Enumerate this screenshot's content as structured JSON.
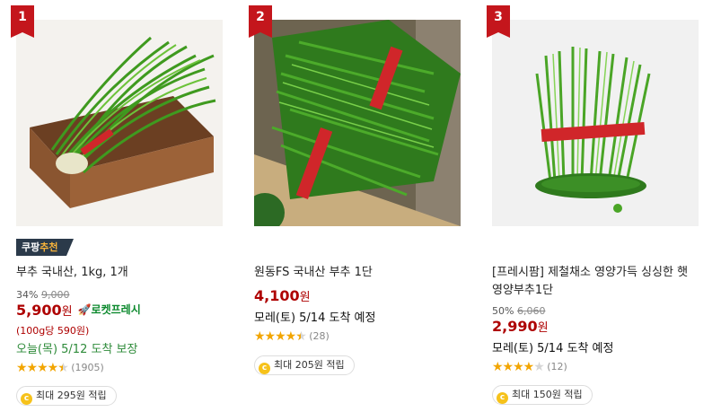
{
  "products": [
    {
      "rank": "1",
      "badge": {
        "prefix": "쿠팡",
        "accent": "추천"
      },
      "name": "부추 국내산, 1kg, 1개",
      "discount": "34%",
      "original_price": "9,000",
      "price": "5,900",
      "currency": "원",
      "rocket_label": "로켓프레시",
      "unit_price": "(100g당 590원)",
      "delivery": "오늘(목) 5/12 도착 보장",
      "rating": 4.5,
      "review_count": "(1905)",
      "reward": "최대 295원 적립"
    },
    {
      "rank": "2",
      "name": "원동FS 국내산 부추 1단",
      "price": "4,100",
      "currency": "원",
      "delivery": "모레(토) 5/14 도착 예정",
      "rating": 4.5,
      "review_count": "(28)",
      "reward": "최대 205원 적립"
    },
    {
      "rank": "3",
      "name": "[프레시팜] 제철채소 영양가득 싱싱한 햇 영양부추1단",
      "discount": "50%",
      "original_price": "6,060",
      "price": "2,990",
      "currency": "원",
      "delivery": "모레(토) 5/14 도착 예정",
      "rating": 4.0,
      "review_count": "(12)",
      "reward": "최대 150원 적립"
    }
  ],
  "colors": {
    "price": "#ae0000",
    "rank": "#c4161c",
    "rocket": "#0e8a2f",
    "star": "#f2a500"
  }
}
